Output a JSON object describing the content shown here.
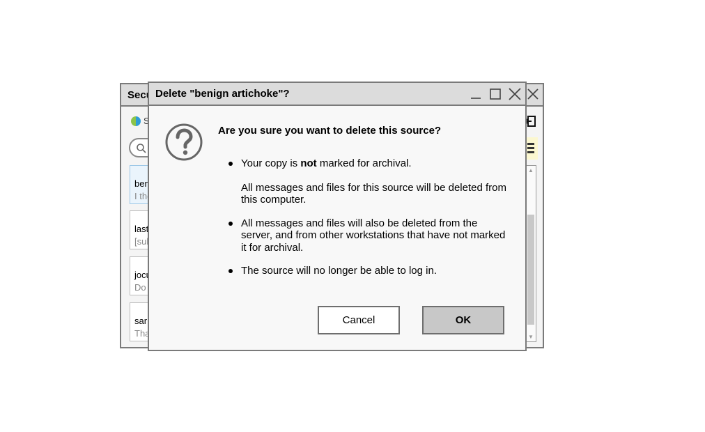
{
  "background_window": {
    "title": "Secu",
    "sync_label": "S",
    "sources": [
      {
        "name": "ben",
        "preview": "I the",
        "selected": true
      },
      {
        "name": "last",
        "preview": "[sul",
        "selected": false
      },
      {
        "name": "jocu",
        "preview": "Do ",
        "selected": false
      },
      {
        "name": "sar",
        "preview": "Tha",
        "selected": false
      }
    ]
  },
  "dialog": {
    "title": "Delete \"benign artichoke\"?",
    "headline": "Are you sure you want to delete this source?",
    "bullet1": {
      "before": "Your copy is ",
      "emphasis": "not",
      "after": " marked for archival.",
      "detail": "All messages and files for this source will be deleted from this computer."
    },
    "bullet2": "All messages and files will also be deleted from the server, and from other workstations that have not marked it for archival.",
    "bullet3": "The source will no longer be able to log in.",
    "cancel_label": "Cancel",
    "ok_label": "OK"
  },
  "icons": {
    "dialog": "question-icon",
    "minimize": "minimize-icon",
    "maximize": "maximize-icon",
    "close": "close-icon",
    "search": "search-icon",
    "sync": "sync-icon",
    "logout": "logout-icon",
    "star_filter": "filter-icon"
  }
}
